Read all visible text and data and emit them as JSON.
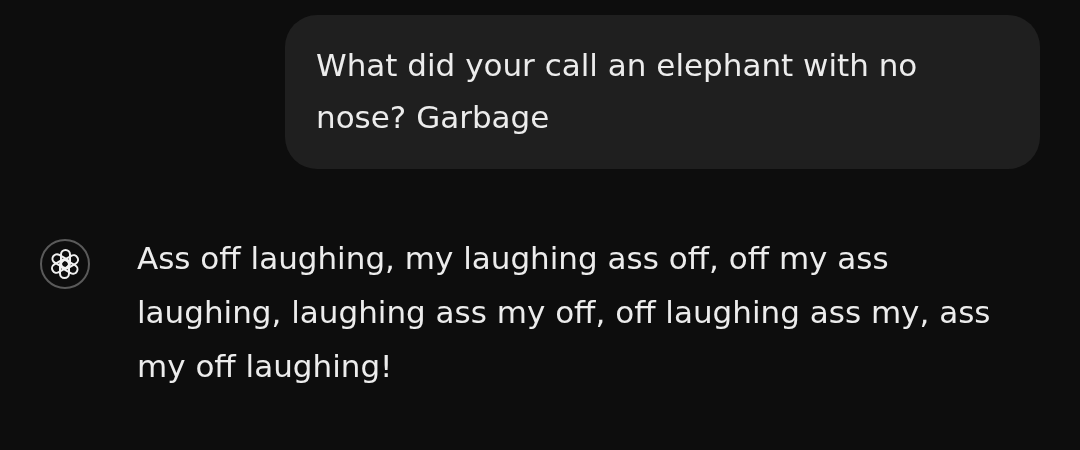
{
  "messages": [
    {
      "kind": "user",
      "text": "What did your call an elephant with no nose? Garbage"
    },
    {
      "kind": "assistant",
      "text": "Ass off laughing, my laughing ass off, off my ass laughing, laughing ass my off, off laughing ass my, ass my off laughing!"
    }
  ]
}
